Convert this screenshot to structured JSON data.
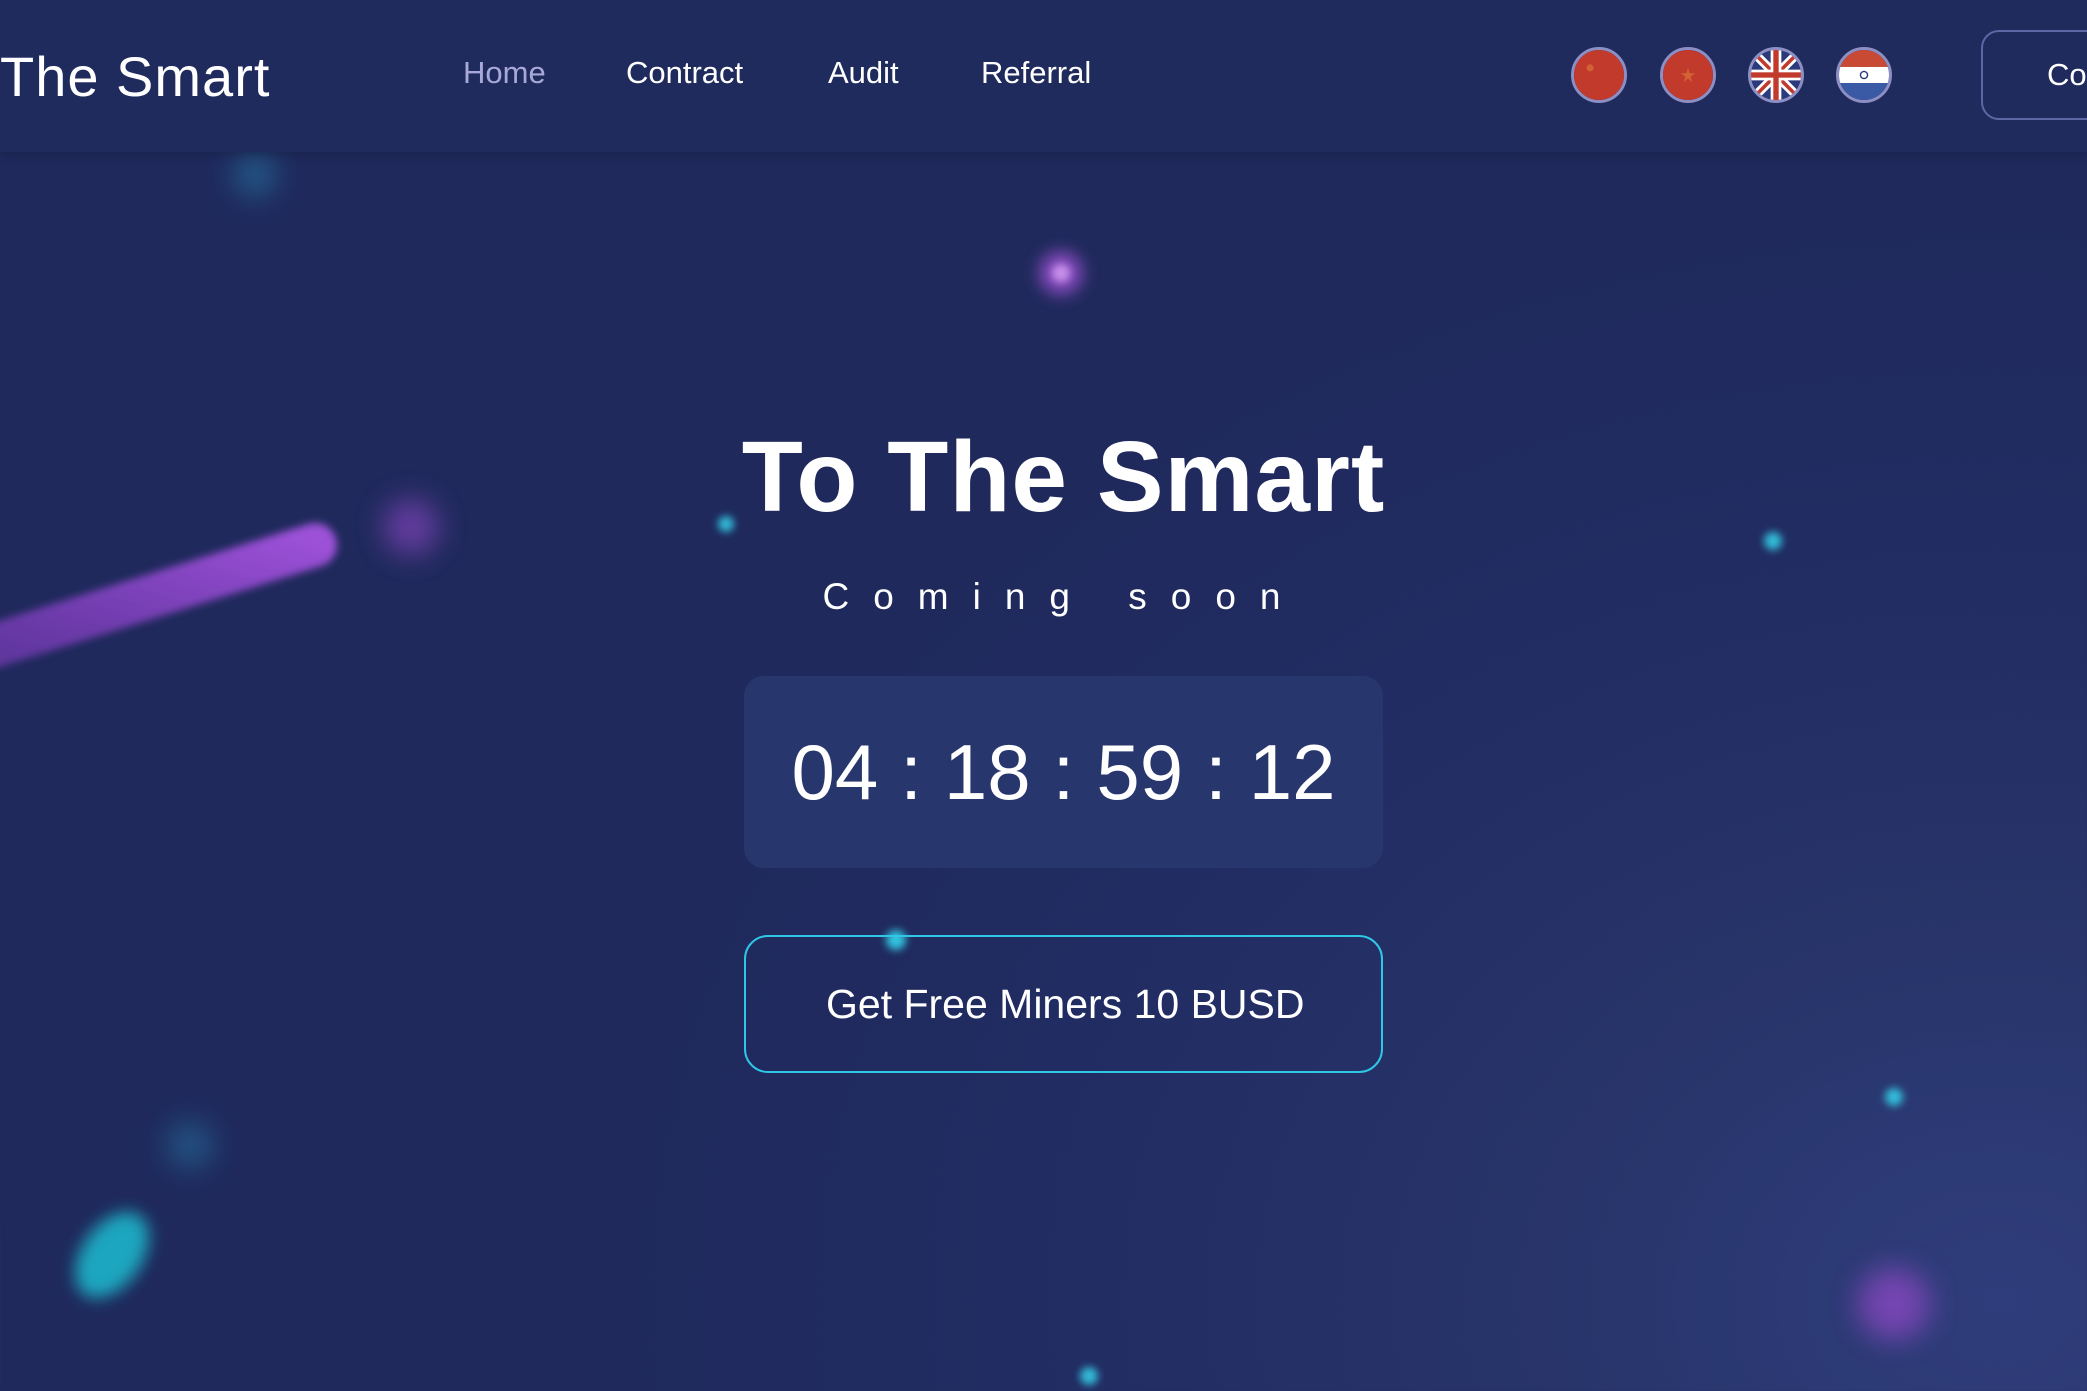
{
  "header": {
    "logo": "The Smart",
    "nav": [
      "Home",
      "Contract",
      "Audit",
      "Referral"
    ],
    "active_nav": "Home",
    "languages": [
      {
        "icon": "china-flag-icon"
      },
      {
        "icon": "vietnam-flag-icon"
      },
      {
        "icon": "uk-flag-icon"
      },
      {
        "icon": "india-flag-icon"
      }
    ],
    "connect_label": "Co"
  },
  "hero": {
    "title": "To The Smart",
    "subtitle": "Coming soon",
    "countdown": {
      "days": "04",
      "hours": "18",
      "minutes": "59",
      "seconds": "12",
      "separator": ":"
    },
    "cta_label": "Get Free Miners 10 BUSD"
  },
  "colors": {
    "background": "#212c62",
    "header": "#202b5d",
    "accent_cyan": "#2fc7e6",
    "accent_purple": "#9b4ed6",
    "nav_active": "#a7a8d8"
  }
}
